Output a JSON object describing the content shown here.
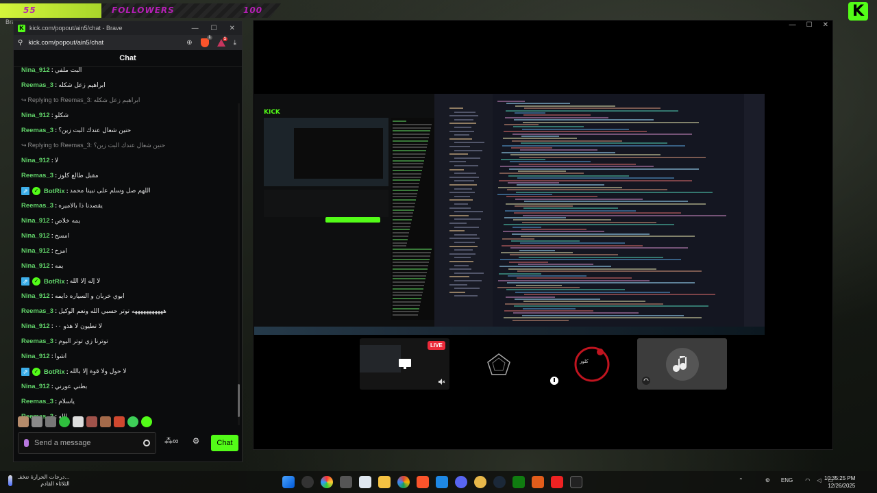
{
  "overlay": {
    "goal_current": "55",
    "goal_label": "FOLLOWERS",
    "goal_target": "100",
    "goal_progress": 0.55,
    "corner_logo": "K",
    "ghost_text": "Bra"
  },
  "colors": {
    "kick_green": "#53fc18",
    "accent_purple": "#b51fb5",
    "live_red": "#eb2a3a",
    "username_green": "#62d46a"
  },
  "chat_window": {
    "tab_title": "kick.com/popout/ain5/chat - Brave",
    "address": "kick.com/popout/ain5/chat",
    "shield_badge": "1",
    "triangle_badge": "1",
    "header": "Chat",
    "messages": [
      {
        "user": "Nina_912",
        "text": "البت ملفي",
        "type": "chat"
      },
      {
        "user": "Reemas_3",
        "text": "ابراهيم زعل شكله",
        "type": "chat"
      },
      {
        "user": "",
        "text": "Replying to Reemas_3: ابراهيم زعل شكله",
        "type": "reply"
      },
      {
        "user": "Nina_912",
        "text": "شكلو",
        "type": "chat"
      },
      {
        "user": "Reemas_3",
        "text": "حنين شعال عندك البت زين؟",
        "type": "chat"
      },
      {
        "user": "",
        "text": "Replying to Reemas_3: حنين شعال عندك البت زين؟",
        "type": "reply"
      },
      {
        "user": "Nina_912",
        "text": "لا",
        "type": "chat"
      },
      {
        "user": "Reemas_3",
        "text": "مقبل طالع كلوز",
        "type": "chat"
      },
      {
        "user": "BotRix",
        "text": "اللهم صل وسلم على نبينا محمد",
        "type": "bot"
      },
      {
        "user": "Reemas_3",
        "text": "يقصدنا ذا بالاميره",
        "type": "chat"
      },
      {
        "user": "Nina_912",
        "text": "يمه خلاص",
        "type": "chat"
      },
      {
        "user": "Nina_912",
        "text": "امسح",
        "type": "chat"
      },
      {
        "user": "Nina_912",
        "text": "امزح",
        "type": "chat"
      },
      {
        "user": "Nina_912",
        "text": "يمه",
        "type": "chat"
      },
      {
        "user": "BotRix",
        "text": "لا إله إلا الله",
        "type": "bot"
      },
      {
        "user": "Nina_912",
        "text": "ابوي خربان و السياره دايمه",
        "type": "chat"
      },
      {
        "user": "Reemas_3",
        "text": "هههههههههههه توتر حسبي الله ونعم الوكيل",
        "type": "chat"
      },
      {
        "user": "Nina_912",
        "text": "لا تطيون لا هذو ٠٠",
        "type": "chat"
      },
      {
        "user": "Reemas_3",
        "text": "توترنا زي توتر اليوم",
        "type": "chat"
      },
      {
        "user": "Nina_912",
        "text": "اشوا",
        "type": "chat"
      },
      {
        "user": "BotRix",
        "text": "لا حول ولا قوة إلا بالله",
        "type": "bot"
      },
      {
        "user": "Nina_912",
        "text": "بطني عورني",
        "type": "chat"
      },
      {
        "user": "Reemas_3",
        "text": "ياسلام",
        "type": "chat"
      },
      {
        "user": "Reemas_3",
        "text": "الله",
        "type": "chat"
      }
    ],
    "input_placeholder": "Send a message",
    "chat_button": "Chat"
  },
  "shared_screen": {
    "kick_brand": "KICK",
    "live_badge": "LIVE",
    "overlay_text": "كلوز"
  },
  "taskbar": {
    "weather_line1": "درجات الحرارة تنخفـ...",
    "weather_line2": "الثلاثاء القادم",
    "lang": "ENG",
    "time": "10:35:25 PM",
    "date": "12/26/2025"
  }
}
